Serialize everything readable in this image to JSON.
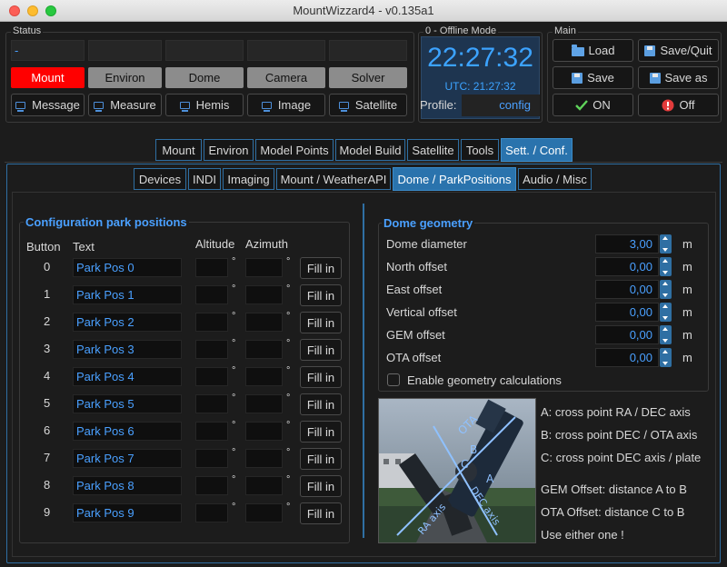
{
  "window": {
    "title": "MountWizzard4 - v0.135a1"
  },
  "status": {
    "title": "Status",
    "dash": "-",
    "buttons_row1": [
      "Mount",
      "Environ",
      "Dome",
      "Camera",
      "Solver"
    ],
    "buttons_row2": [
      "Message",
      "Measure",
      "Hemis",
      "Image",
      "Satellite"
    ]
  },
  "clock": {
    "title": "0 - Offline Mode",
    "time": "22:27:32",
    "utc": "UTC: 21:27:32",
    "profile_label": "Profile:",
    "profile_value": "config"
  },
  "main": {
    "title": "Main",
    "load": "Load",
    "save_quit": "Save/Quit",
    "save": "Save",
    "save_as": "Save as",
    "on": "ON",
    "off": "Off"
  },
  "tabs": [
    "Mount",
    "Environ",
    "Model Points",
    "Model Build",
    "Satellite",
    "Tools",
    "Sett. / Conf."
  ],
  "subtabs": [
    "Devices",
    "INDI",
    "Imaging",
    "Mount / WeatherAPI",
    "Dome / ParkPositions",
    "Audio / Misc"
  ],
  "park": {
    "title": "Configuration park positions",
    "col_button": "Button",
    "col_text": "Text",
    "col_altitude": "Altitude",
    "col_azimuth": "Azimuth",
    "degree": "°",
    "fill_label": "Fill in",
    "rows": [
      {
        "num": "0",
        "name": "Park Pos 0"
      },
      {
        "num": "1",
        "name": "Park Pos 1"
      },
      {
        "num": "2",
        "name": "Park Pos 2"
      },
      {
        "num": "3",
        "name": "Park Pos 3"
      },
      {
        "num": "4",
        "name": "Park Pos 4"
      },
      {
        "num": "5",
        "name": "Park Pos 5"
      },
      {
        "num": "6",
        "name": "Park Pos 6"
      },
      {
        "num": "7",
        "name": "Park Pos 7"
      },
      {
        "num": "8",
        "name": "Park Pos 8"
      },
      {
        "num": "9",
        "name": "Park Pos 9"
      }
    ]
  },
  "dome": {
    "title": "Dome geometry",
    "unit": "m",
    "fields": [
      {
        "label": "Dome diameter",
        "value": "3,00"
      },
      {
        "label": "North offset",
        "value": "0,00"
      },
      {
        "label": "East offset",
        "value": "0,00"
      },
      {
        "label": "Vertical offset",
        "value": "0,00"
      },
      {
        "label": "GEM offset",
        "value": "0,00"
      },
      {
        "label": "OTA offset",
        "value": "0,00"
      }
    ],
    "enable_label": "Enable geometry calculations",
    "image_labels": {
      "ota": "OTA",
      "a": "A",
      "b": "B",
      "c": "C",
      "ra": "RA axis",
      "dec": "DEC axis"
    },
    "notes": [
      "A: cross point RA / DEC axis",
      "B: cross point DEC / OTA axis",
      "C: cross point DEC axis / plate",
      "GEM Offset: distance A to B",
      "OTA Offset: distance C to B",
      "Use either one !"
    ]
  }
}
